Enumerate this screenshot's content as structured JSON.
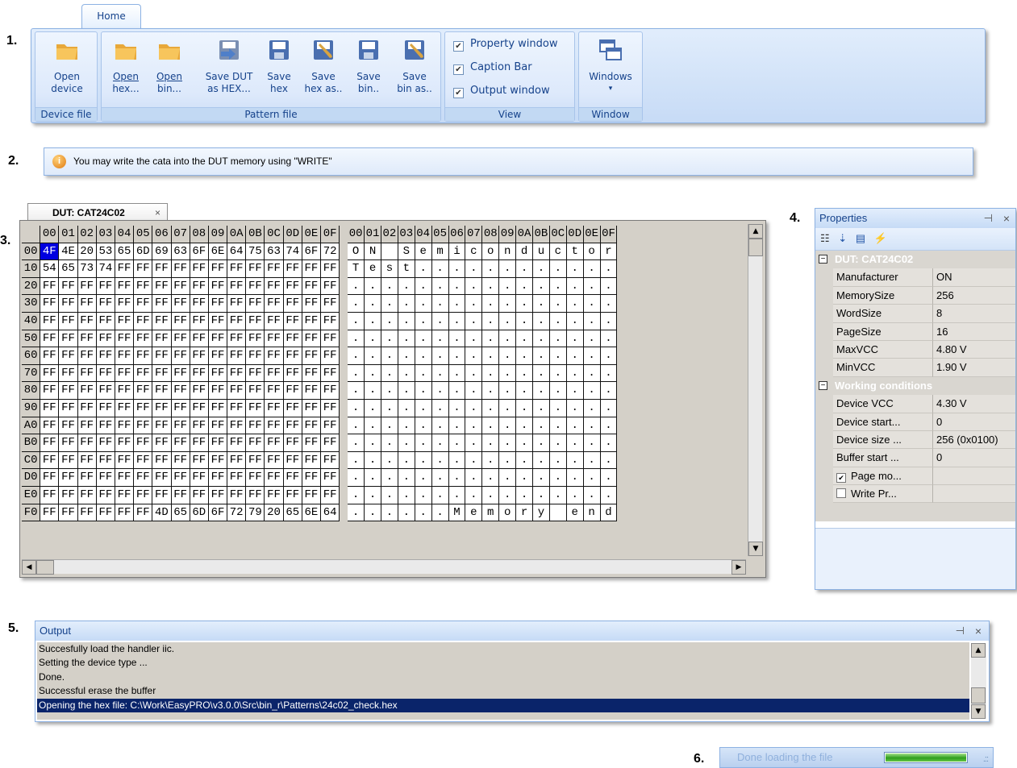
{
  "markers": [
    "1.",
    "2.",
    "3.",
    "4.",
    "5.",
    "6."
  ],
  "ribbon": {
    "tab": "Home",
    "groups": [
      {
        "label": "Device file",
        "buttons": [
          {
            "line1": "Open",
            "line2": "device",
            "icon": "folder-open-icon"
          }
        ]
      },
      {
        "label": "Pattern file",
        "buttons": [
          {
            "line1": "Open",
            "line2": "hex...",
            "icon": "folder-open-icon"
          },
          {
            "line1": "Open",
            "line2": "bin...",
            "icon": "folder-open-icon"
          },
          {
            "line1": "Save DUT",
            "line2": "as HEX...",
            "icon": "save-dut-icon"
          },
          {
            "line1": "Save",
            "line2": "hex",
            "icon": "floppy-icon"
          },
          {
            "line1": "Save",
            "line2": "hex as..",
            "icon": "floppy-edit-icon"
          },
          {
            "line1": "Save",
            "line2": "bin..",
            "icon": "floppy-icon"
          },
          {
            "line1": "Save",
            "line2": "bin as..",
            "icon": "floppy-edit-icon"
          }
        ]
      },
      {
        "label": "View",
        "checks": [
          {
            "label": "Property window",
            "checked": true
          },
          {
            "label": "Caption Bar",
            "checked": true
          },
          {
            "label": "Output window",
            "checked": true
          }
        ]
      },
      {
        "label": "Window",
        "buttons": [
          {
            "line1": "Windows",
            "line2": "▾",
            "icon": "windows-icon"
          }
        ]
      }
    ]
  },
  "infobar": {
    "icon": "info-icon",
    "text": "You may write the cata into the DUT memory using \"WRITE\""
  },
  "editor": {
    "tab": "DUT: CAT24C02",
    "tab_close": "×",
    "hex_columns": [
      "00",
      "01",
      "02",
      "03",
      "04",
      "05",
      "06",
      "07",
      "08",
      "09",
      "0A",
      "0B",
      "0C",
      "0D",
      "0E",
      "0F"
    ],
    "ascii_header": [
      "00",
      "01",
      "02",
      "03",
      "04",
      "05",
      "06",
      "07",
      "08",
      "09",
      "0A",
      "0B",
      "0C",
      "0D",
      "0E",
      "0F"
    ],
    "selected_cell": {
      "row": 0,
      "col": 0
    },
    "rows": [
      {
        "addr": "00",
        "hex": [
          "4F",
          "4E",
          "20",
          "53",
          "65",
          "6D",
          "69",
          "63",
          "6F",
          "6E",
          "64",
          "75",
          "63",
          "74",
          "6F",
          "72"
        ],
        "ascii": [
          "O",
          "N",
          " ",
          "S",
          "e",
          "m",
          "i",
          "c",
          "o",
          "n",
          "d",
          "u",
          "c",
          "t",
          "o",
          "r"
        ]
      },
      {
        "addr": "10",
        "hex": [
          "54",
          "65",
          "73",
          "74",
          "FF",
          "FF",
          "FF",
          "FF",
          "FF",
          "FF",
          "FF",
          "FF",
          "FF",
          "FF",
          "FF",
          "FF"
        ],
        "ascii": [
          "T",
          "e",
          "s",
          "t",
          ".",
          ".",
          ".",
          ".",
          ".",
          ".",
          ".",
          ".",
          ".",
          ".",
          ".",
          "."
        ]
      },
      {
        "addr": "20",
        "hex": [
          "FF",
          "FF",
          "FF",
          "FF",
          "FF",
          "FF",
          "FF",
          "FF",
          "FF",
          "FF",
          "FF",
          "FF",
          "FF",
          "FF",
          "FF",
          "FF"
        ],
        "ascii": [
          ".",
          ".",
          ".",
          ".",
          ".",
          ".",
          ".",
          ".",
          ".",
          ".",
          ".",
          ".",
          ".",
          ".",
          ".",
          "."
        ]
      },
      {
        "addr": "30",
        "hex": [
          "FF",
          "FF",
          "FF",
          "FF",
          "FF",
          "FF",
          "FF",
          "FF",
          "FF",
          "FF",
          "FF",
          "FF",
          "FF",
          "FF",
          "FF",
          "FF"
        ],
        "ascii": [
          ".",
          ".",
          ".",
          ".",
          ".",
          ".",
          ".",
          ".",
          ".",
          ".",
          ".",
          ".",
          ".",
          ".",
          ".",
          "."
        ]
      },
      {
        "addr": "40",
        "hex": [
          "FF",
          "FF",
          "FF",
          "FF",
          "FF",
          "FF",
          "FF",
          "FF",
          "FF",
          "FF",
          "FF",
          "FF",
          "FF",
          "FF",
          "FF",
          "FF"
        ],
        "ascii": [
          ".",
          ".",
          ".",
          ".",
          ".",
          ".",
          ".",
          ".",
          ".",
          ".",
          ".",
          ".",
          ".",
          ".",
          ".",
          "."
        ]
      },
      {
        "addr": "50",
        "hex": [
          "FF",
          "FF",
          "FF",
          "FF",
          "FF",
          "FF",
          "FF",
          "FF",
          "FF",
          "FF",
          "FF",
          "FF",
          "FF",
          "FF",
          "FF",
          "FF"
        ],
        "ascii": [
          ".",
          ".",
          ".",
          ".",
          ".",
          ".",
          ".",
          ".",
          ".",
          ".",
          ".",
          ".",
          ".",
          ".",
          ".",
          "."
        ]
      },
      {
        "addr": "60",
        "hex": [
          "FF",
          "FF",
          "FF",
          "FF",
          "FF",
          "FF",
          "FF",
          "FF",
          "FF",
          "FF",
          "FF",
          "FF",
          "FF",
          "FF",
          "FF",
          "FF"
        ],
        "ascii": [
          ".",
          ".",
          ".",
          ".",
          ".",
          ".",
          ".",
          ".",
          ".",
          ".",
          ".",
          ".",
          ".",
          ".",
          ".",
          "."
        ]
      },
      {
        "addr": "70",
        "hex": [
          "FF",
          "FF",
          "FF",
          "FF",
          "FF",
          "FF",
          "FF",
          "FF",
          "FF",
          "FF",
          "FF",
          "FF",
          "FF",
          "FF",
          "FF",
          "FF"
        ],
        "ascii": [
          ".",
          ".",
          ".",
          ".",
          ".",
          ".",
          ".",
          ".",
          ".",
          ".",
          ".",
          ".",
          ".",
          ".",
          ".",
          "."
        ]
      },
      {
        "addr": "80",
        "hex": [
          "FF",
          "FF",
          "FF",
          "FF",
          "FF",
          "FF",
          "FF",
          "FF",
          "FF",
          "FF",
          "FF",
          "FF",
          "FF",
          "FF",
          "FF",
          "FF"
        ],
        "ascii": [
          ".",
          ".",
          ".",
          ".",
          ".",
          ".",
          ".",
          ".",
          ".",
          ".",
          ".",
          ".",
          ".",
          ".",
          ".",
          "."
        ]
      },
      {
        "addr": "90",
        "hex": [
          "FF",
          "FF",
          "FF",
          "FF",
          "FF",
          "FF",
          "FF",
          "FF",
          "FF",
          "FF",
          "FF",
          "FF",
          "FF",
          "FF",
          "FF",
          "FF"
        ],
        "ascii": [
          ".",
          ".",
          ".",
          ".",
          ".",
          ".",
          ".",
          ".",
          ".",
          ".",
          ".",
          ".",
          ".",
          ".",
          ".",
          "."
        ]
      },
      {
        "addr": "A0",
        "hex": [
          "FF",
          "FF",
          "FF",
          "FF",
          "FF",
          "FF",
          "FF",
          "FF",
          "FF",
          "FF",
          "FF",
          "FF",
          "FF",
          "FF",
          "FF",
          "FF"
        ],
        "ascii": [
          ".",
          ".",
          ".",
          ".",
          ".",
          ".",
          ".",
          ".",
          ".",
          ".",
          ".",
          ".",
          ".",
          ".",
          ".",
          "."
        ]
      },
      {
        "addr": "B0",
        "hex": [
          "FF",
          "FF",
          "FF",
          "FF",
          "FF",
          "FF",
          "FF",
          "FF",
          "FF",
          "FF",
          "FF",
          "FF",
          "FF",
          "FF",
          "FF",
          "FF"
        ],
        "ascii": [
          ".",
          ".",
          ".",
          ".",
          ".",
          ".",
          ".",
          ".",
          ".",
          ".",
          ".",
          ".",
          ".",
          ".",
          ".",
          "."
        ]
      },
      {
        "addr": "C0",
        "hex": [
          "FF",
          "FF",
          "FF",
          "FF",
          "FF",
          "FF",
          "FF",
          "FF",
          "FF",
          "FF",
          "FF",
          "FF",
          "FF",
          "FF",
          "FF",
          "FF"
        ],
        "ascii": [
          ".",
          ".",
          ".",
          ".",
          ".",
          ".",
          ".",
          ".",
          ".",
          ".",
          ".",
          ".",
          ".",
          ".",
          ".",
          "."
        ]
      },
      {
        "addr": "D0",
        "hex": [
          "FF",
          "FF",
          "FF",
          "FF",
          "FF",
          "FF",
          "FF",
          "FF",
          "FF",
          "FF",
          "FF",
          "FF",
          "FF",
          "FF",
          "FF",
          "FF"
        ],
        "ascii": [
          ".",
          ".",
          ".",
          ".",
          ".",
          ".",
          ".",
          ".",
          ".",
          ".",
          ".",
          ".",
          ".",
          ".",
          ".",
          "."
        ]
      },
      {
        "addr": "E0",
        "hex": [
          "FF",
          "FF",
          "FF",
          "FF",
          "FF",
          "FF",
          "FF",
          "FF",
          "FF",
          "FF",
          "FF",
          "FF",
          "FF",
          "FF",
          "FF",
          "FF"
        ],
        "ascii": [
          ".",
          ".",
          ".",
          ".",
          ".",
          ".",
          ".",
          ".",
          ".",
          ".",
          ".",
          ".",
          ".",
          ".",
          ".",
          "."
        ]
      },
      {
        "addr": "F0",
        "hex": [
          "FF",
          "FF",
          "FF",
          "FF",
          "FF",
          "FF",
          "4D",
          "65",
          "6D",
          "6F",
          "72",
          "79",
          "20",
          "65",
          "6E",
          "64"
        ],
        "ascii": [
          ".",
          ".",
          ".",
          ".",
          ".",
          ".",
          "M",
          "e",
          "m",
          "o",
          "r",
          "y",
          " ",
          "e",
          "n",
          "d"
        ]
      }
    ]
  },
  "properties": {
    "title": "Properties",
    "pin": "ᴘ",
    "close": "×",
    "toolbar": [
      "categorized-icon",
      "sort-az-icon",
      "property-pages-icon",
      "events-icon"
    ],
    "categories": [
      {
        "name": "DUT: CAT24C02",
        "expanded": true,
        "items": [
          {
            "name": "Manufacturer",
            "value": "ON"
          },
          {
            "name": "MemorySize",
            "value": "256"
          },
          {
            "name": "WordSize",
            "value": "8"
          },
          {
            "name": "PageSize",
            "value": "16"
          },
          {
            "name": "MaxVCC",
            "value": "4.80 V"
          },
          {
            "name": "MinVCC",
            "value": "1.90 V"
          }
        ]
      },
      {
        "name": "Working conditions",
        "expanded": true,
        "items": [
          {
            "name": "Device VCC",
            "value": "4.30 V"
          },
          {
            "name": "Device start...",
            "value": "0"
          },
          {
            "name": "Device size ...",
            "value": "256 (0x0100)"
          },
          {
            "name": "Buffer start ...",
            "value": "0"
          },
          {
            "name": "Page mo...",
            "value": "",
            "checkbox": true,
            "checked": true
          },
          {
            "name": "Write Pr...",
            "value": "",
            "checkbox": true,
            "checked": false
          }
        ]
      }
    ]
  },
  "output": {
    "title": "Output",
    "pin": "ᴘ",
    "close": "×",
    "lines": [
      "Succesfully load the handler iic.",
      "Setting the device type ...",
      "Done.",
      "Successful erase the buffer",
      "Opening the hex file: C:\\Work\\EasyPRO\\v3.0.0\\Src\\bin_r\\Patterns\\24c02_check.hex"
    ],
    "selected_line": 4
  },
  "statusbar": {
    "text": "Done loading the file",
    "progress": 1.0,
    "grip": ".::"
  },
  "colors": {
    "ribbon_text": "#15428b",
    "selection": "#0000e0",
    "output_selection": "#0a246a",
    "progress": "#2f9e1d"
  }
}
